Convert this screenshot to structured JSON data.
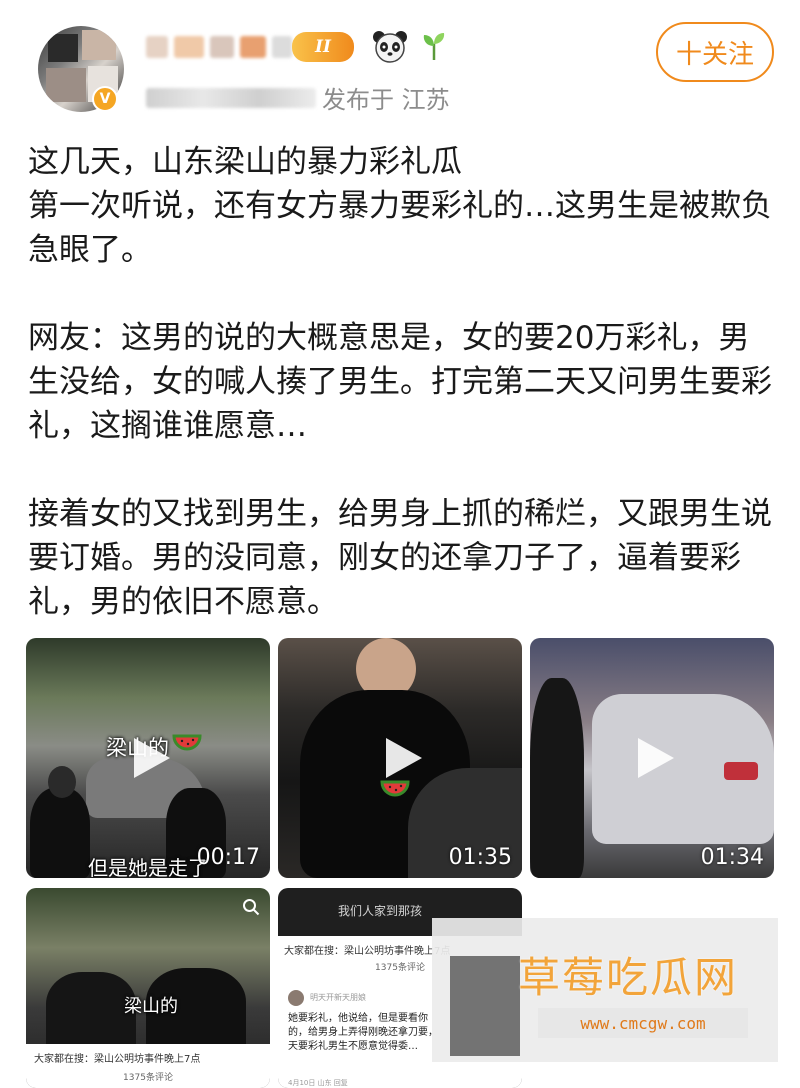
{
  "header": {
    "publish_location": "发布于 江苏",
    "verified_badge": "V",
    "level_badge": "II",
    "icons": [
      "panda-icon",
      "sprout-icon"
    ],
    "follow_label": "十关注"
  },
  "post": {
    "paragraphs": [
      "这几天，山东梁山的暴力彩礼瓜\n第一次听说，还有女方暴力要彩礼的…这男生是被欺负急眼了。",
      "网友：这男的说的大概意思是，女的要20万彩礼，男生没给，女的喊人揍了男生。打完第二天又问男生要彩礼，这搁谁谁愿意…",
      "接着女的又找到男生，给男身上抓的稀烂，又跟男生说要订婚。男的没同意，刚女的还拿刀子了，逼着要彩礼，男的依旧不愿意。"
    ]
  },
  "media": {
    "videos": [
      {
        "duration": "00:17",
        "caption_top": "梁山的",
        "caption_bottom": "但是她是走了"
      },
      {
        "duration": "01:35"
      },
      {
        "duration": "01:34"
      }
    ],
    "image4": {
      "overlay": "梁山的",
      "caption": "大家都在搜：梁山公明坊事件晚上7点",
      "comment_count": "1375条评论"
    },
    "image5": {
      "top_caption": "我们人家到那孩",
      "caption": "大家都在搜：梁山公明坊事件晚上7点",
      "comment_count": "1375条评论",
      "commenter": "明天开新天朋娘",
      "comment": "她要彩礼，他说给，但是要看你的，给男身上弄得刚晚还拿刀要，天要彩礼男生不愿意觉得委…",
      "footer": "4月10日 山东 回复"
    }
  },
  "watermark": {
    "title": "草莓吃瓜网",
    "url": "www.cmcgw.com"
  },
  "colors": {
    "accent": "#f08a1c",
    "watermark_text": "#f2a43a",
    "meta_text": "#8c8c8c"
  }
}
